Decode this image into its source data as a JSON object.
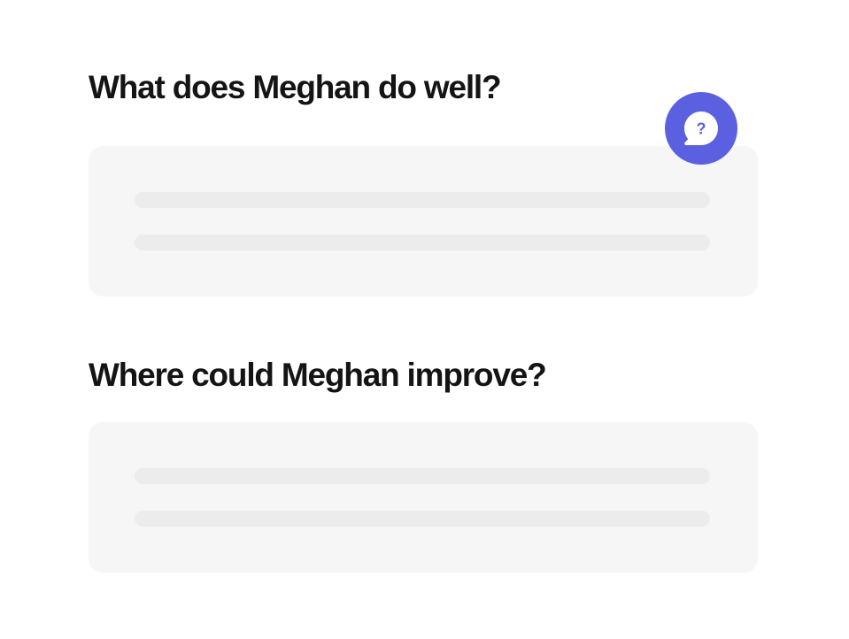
{
  "questions": [
    {
      "label": "What does Meghan do well?"
    },
    {
      "label": "Where could Meghan improve?"
    }
  ],
  "help": {
    "icon": "question-chat-bubble-icon",
    "glyph": "?",
    "color": "#5b60e0"
  }
}
